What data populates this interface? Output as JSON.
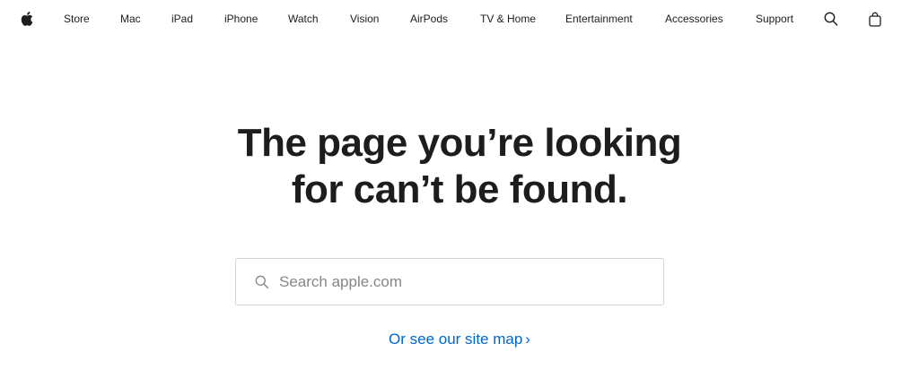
{
  "nav": {
    "items": [
      {
        "label": "Store"
      },
      {
        "label": "Mac"
      },
      {
        "label": "iPad"
      },
      {
        "label": "iPhone"
      },
      {
        "label": "Watch"
      },
      {
        "label": "Vision"
      },
      {
        "label": "AirPods"
      },
      {
        "label": "TV & Home"
      },
      {
        "label": "Entertainment"
      },
      {
        "label": "Accessories"
      },
      {
        "label": "Support"
      }
    ],
    "icons": {
      "logo": "apple-logo-icon",
      "search": "search-icon",
      "bag": "shopping-bag-icon"
    }
  },
  "main": {
    "headline_line1": "The page you’re looking",
    "headline_line2": "for can’t be found.",
    "search": {
      "placeholder": "Search apple.com",
      "value": ""
    },
    "sitemap_link": "Or see our site map",
    "sitemap_chevron": "›"
  },
  "colors": {
    "text": "#1d1d1f",
    "link": "#0066cc",
    "border": "#d2d2d7",
    "placeholder": "#86868b"
  }
}
